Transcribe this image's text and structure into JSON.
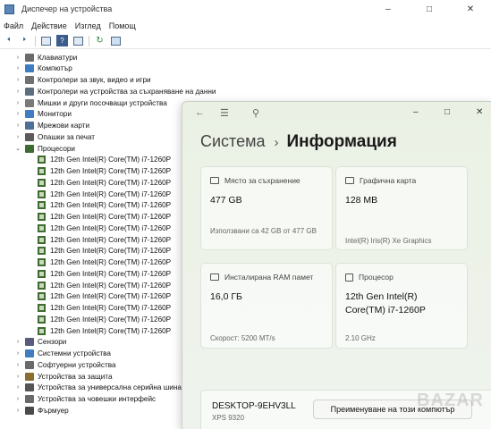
{
  "device_manager": {
    "title": "Диспечер на устройства",
    "menu": [
      "Файл",
      "Действие",
      "Изглед",
      "Помощ"
    ],
    "tree": [
      {
        "label": "Клавиатури",
        "expanded": false,
        "icon": "keyboard-icon",
        "color": "#6b6b6b"
      },
      {
        "label": "Компютър",
        "expanded": false,
        "icon": "computer-icon",
        "color": "#3f7cc0"
      },
      {
        "label": "Контролери за звук, видео и игри",
        "expanded": false,
        "icon": "speaker-icon",
        "color": "#707070"
      },
      {
        "label": "Контролери на устройства за съхраняване на данни",
        "expanded": false,
        "icon": "storage-controller-icon",
        "color": "#5d6f7f"
      },
      {
        "label": "Мишки и други посочващи устройства",
        "expanded": false,
        "icon": "mouse-icon",
        "color": "#7a7a7a"
      },
      {
        "label": "Монитори",
        "expanded": false,
        "icon": "monitor-icon",
        "color": "#3f7cc0"
      },
      {
        "label": "Мрежови карти",
        "expanded": false,
        "icon": "network-icon",
        "color": "#4f6f9a"
      },
      {
        "label": "Опашки за печат",
        "expanded": false,
        "icon": "printer-icon",
        "color": "#5b5b5b"
      },
      {
        "label": "Процесори",
        "expanded": true,
        "icon": "processor-icon",
        "color": "#3f6b31"
      },
      {
        "label": "Сензори",
        "expanded": false,
        "icon": "sensor-icon",
        "color": "#5a5a7a"
      },
      {
        "label": "Системни устройства",
        "expanded": false,
        "icon": "system-device-icon",
        "color": "#3f7cc0"
      },
      {
        "label": "Софтуерни устройства",
        "expanded": false,
        "icon": "software-device-icon",
        "color": "#6a6a6a"
      },
      {
        "label": "Устройства за защита",
        "expanded": false,
        "icon": "security-device-icon",
        "color": "#8a6d2f"
      },
      {
        "label": "Устройства за универсална серийна шина",
        "expanded": false,
        "icon": "usb-icon",
        "color": "#555555"
      },
      {
        "label": "Устройства за човешки интерфейс",
        "expanded": false,
        "icon": "hid-icon",
        "color": "#6a6a6a"
      },
      {
        "label": "Фърмуер",
        "expanded": false,
        "icon": "firmware-icon",
        "color": "#4a4a4a"
      }
    ],
    "processors": [
      "12th Gen Intel(R) Core(TM) i7-1260P",
      "12th Gen Intel(R) Core(TM) i7-1260P",
      "12th Gen Intel(R) Core(TM) i7-1260P",
      "12th Gen Intel(R) Core(TM) i7-1260P",
      "12th Gen Intel(R) Core(TM) i7-1260P",
      "12th Gen Intel(R) Core(TM) i7-1260P",
      "12th Gen Intel(R) Core(TM) i7-1260P",
      "12th Gen Intel(R) Core(TM) i7-1260P",
      "12th Gen Intel(R) Core(TM) i7-1260P",
      "12th Gen Intel(R) Core(TM) i7-1260P",
      "12th Gen Intel(R) Core(TM) i7-1260P",
      "12th Gen Intel(R) Core(TM) i7-1260P",
      "12th Gen Intel(R) Core(TM) i7-1260P",
      "12th Gen Intel(R) Core(TM) i7-1260P",
      "12th Gen Intel(R) Core(TM) i7-1260P",
      "12th Gen Intel(R) Core(TM) i7-1260P"
    ]
  },
  "settings": {
    "breadcrumb": "Система",
    "page_title": "Информация",
    "storage": {
      "title": "Място за съхранение",
      "value": "477 GB",
      "detail": "Използвани са 42 GB от 477 GB"
    },
    "graphics": {
      "title": "Графична карта",
      "value": "128 MB",
      "detail": "Intel(R) Iris(R) Xe Graphics"
    },
    "ram": {
      "title": "Инсталирана RAM памет",
      "value": "16,0 ГБ",
      "detail": "Скорост: 5200 MT/s"
    },
    "cpu": {
      "title": "Процесор",
      "value": "12th Gen Intel(R) Core(TM) i7-1260P",
      "detail": "2.10 GHz"
    },
    "device_name": "DESKTOP-9EHV3LL",
    "device_model": "XPS 9320",
    "rename_label": "Преименуване на този компютър"
  },
  "watermark": "BAZAR"
}
